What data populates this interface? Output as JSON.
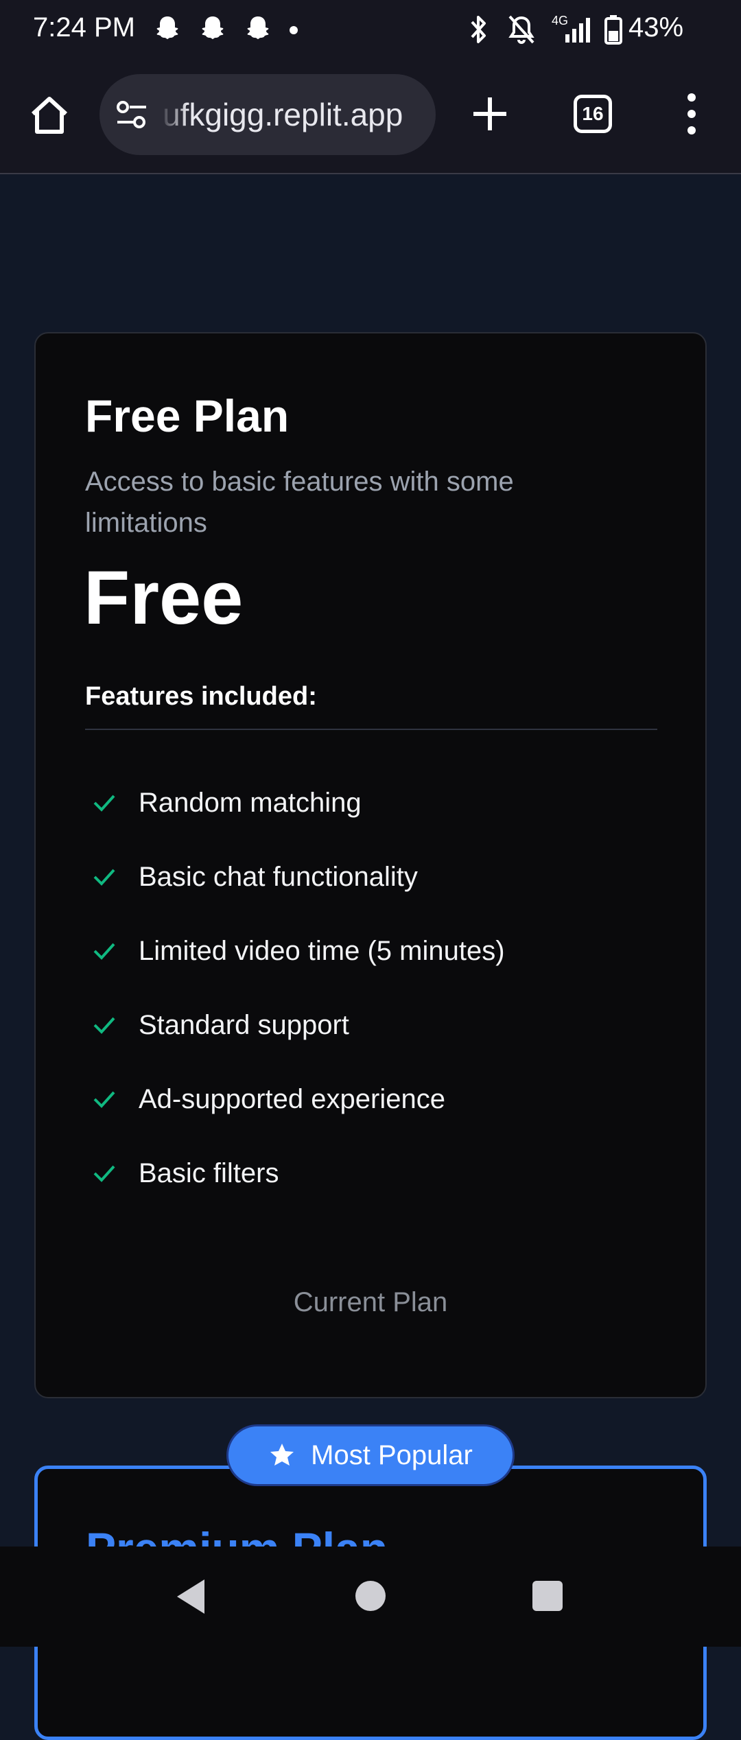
{
  "status_bar": {
    "time": "7:24 PM",
    "notification_icons": [
      "snapchat-icon",
      "snapchat-icon",
      "snapchat-icon"
    ],
    "network": "4G",
    "battery": "43%"
  },
  "browser": {
    "url": "ufkgigg.replit.app",
    "tab_count": "16"
  },
  "free_plan": {
    "title": "Free Plan",
    "description": "Access to basic features with some limitations",
    "price": "Free",
    "features_heading": "Features included:",
    "features": [
      "Random matching",
      "Basic chat functionality",
      "Limited video time (5 minutes)",
      "Standard support",
      "Ad-supported experience",
      "Basic filters"
    ],
    "button_label": "Current Plan"
  },
  "premium_plan": {
    "badge": "Most Popular",
    "title": "Premium Plan"
  },
  "colors": {
    "background": "#111827",
    "card": "#0a0a0c",
    "accent": "#3b82f6",
    "check": "#10b981"
  }
}
